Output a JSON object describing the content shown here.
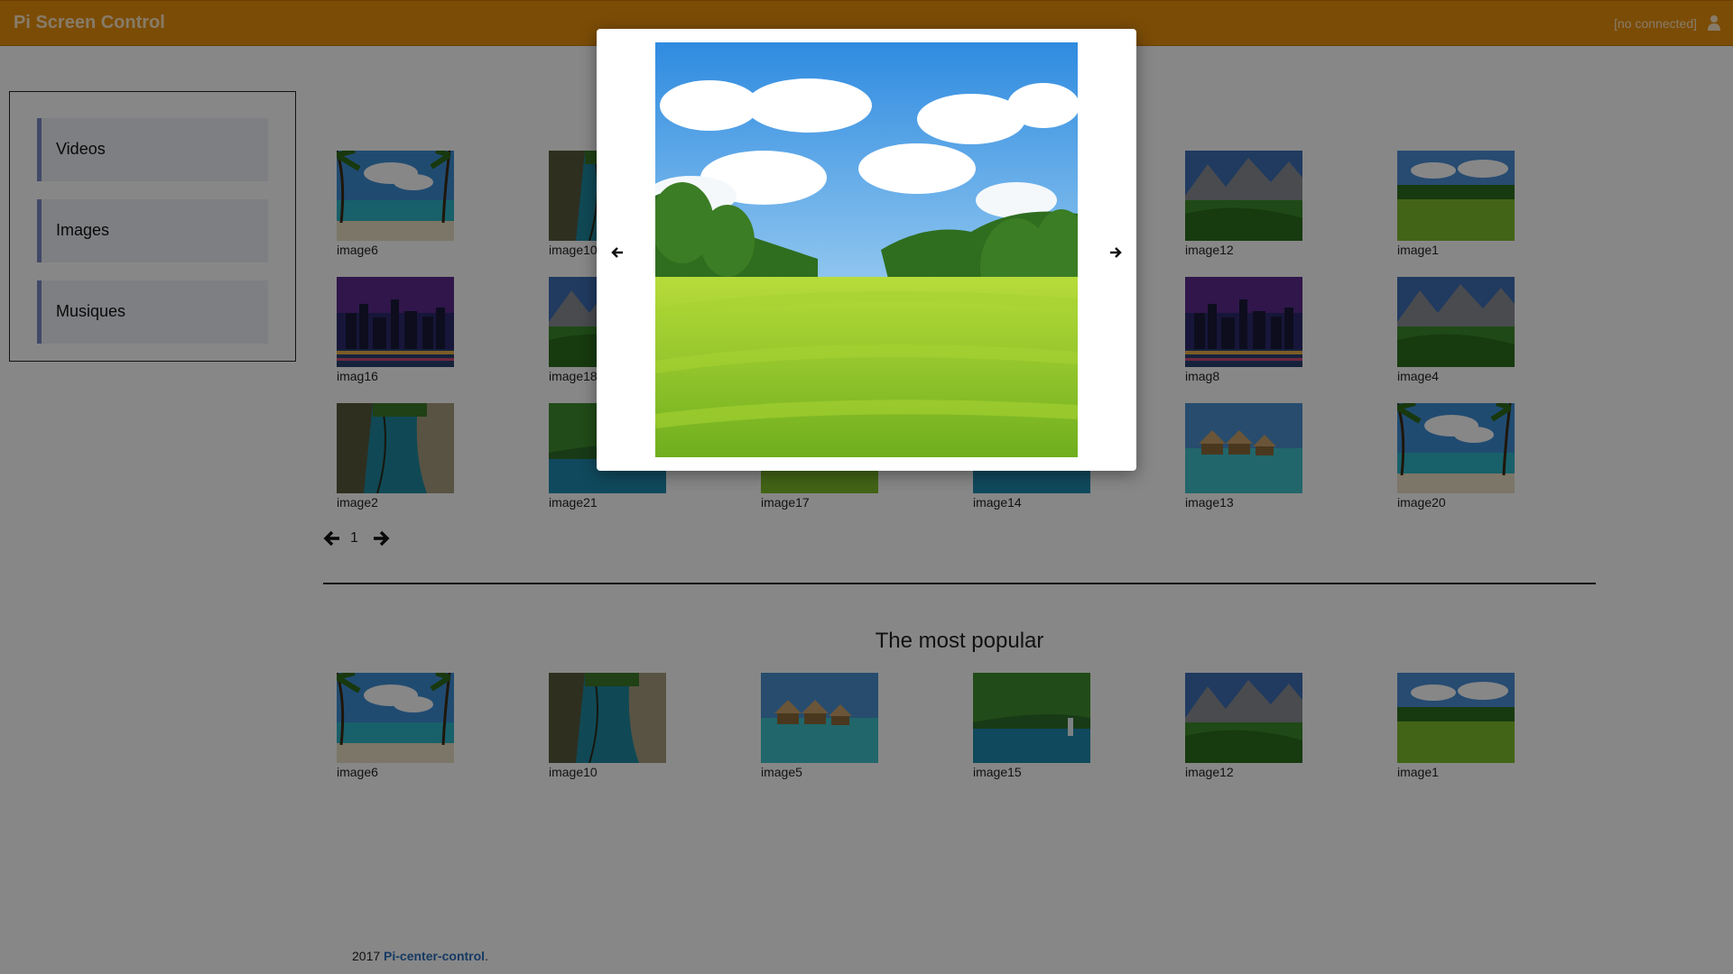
{
  "header": {
    "brand": "Pi Screen Control",
    "connection_status": "[no connected]",
    "user_icon": "user-icon"
  },
  "sidebar": {
    "items": [
      {
        "label": "Videos"
      },
      {
        "label": "Images"
      },
      {
        "label": "Musiques"
      }
    ]
  },
  "gallery": {
    "rows": [
      [
        "image6",
        "image10",
        "",
        "",
        "image12",
        "image1"
      ],
      [
        "imag16",
        "image18",
        "",
        "",
        "imag8",
        "image4"
      ],
      [
        "image2",
        "image21",
        "image17",
        "image14",
        "image13",
        "image20"
      ]
    ],
    "pager": {
      "page": "1",
      "prev_icon": "arrow-left-icon",
      "next_icon": "arrow-right-icon"
    }
  },
  "popular": {
    "title": "The most popular",
    "items": [
      "image6",
      "image10",
      "image5",
      "image15",
      "image12",
      "image1"
    ]
  },
  "footer": {
    "year": "2017",
    "link": "Pi-center-control",
    "suffix": "."
  },
  "modal": {
    "prev_icon": "arrow-left-icon",
    "next_icon": "arrow-right-icon",
    "image": "golf-course-landscape"
  }
}
